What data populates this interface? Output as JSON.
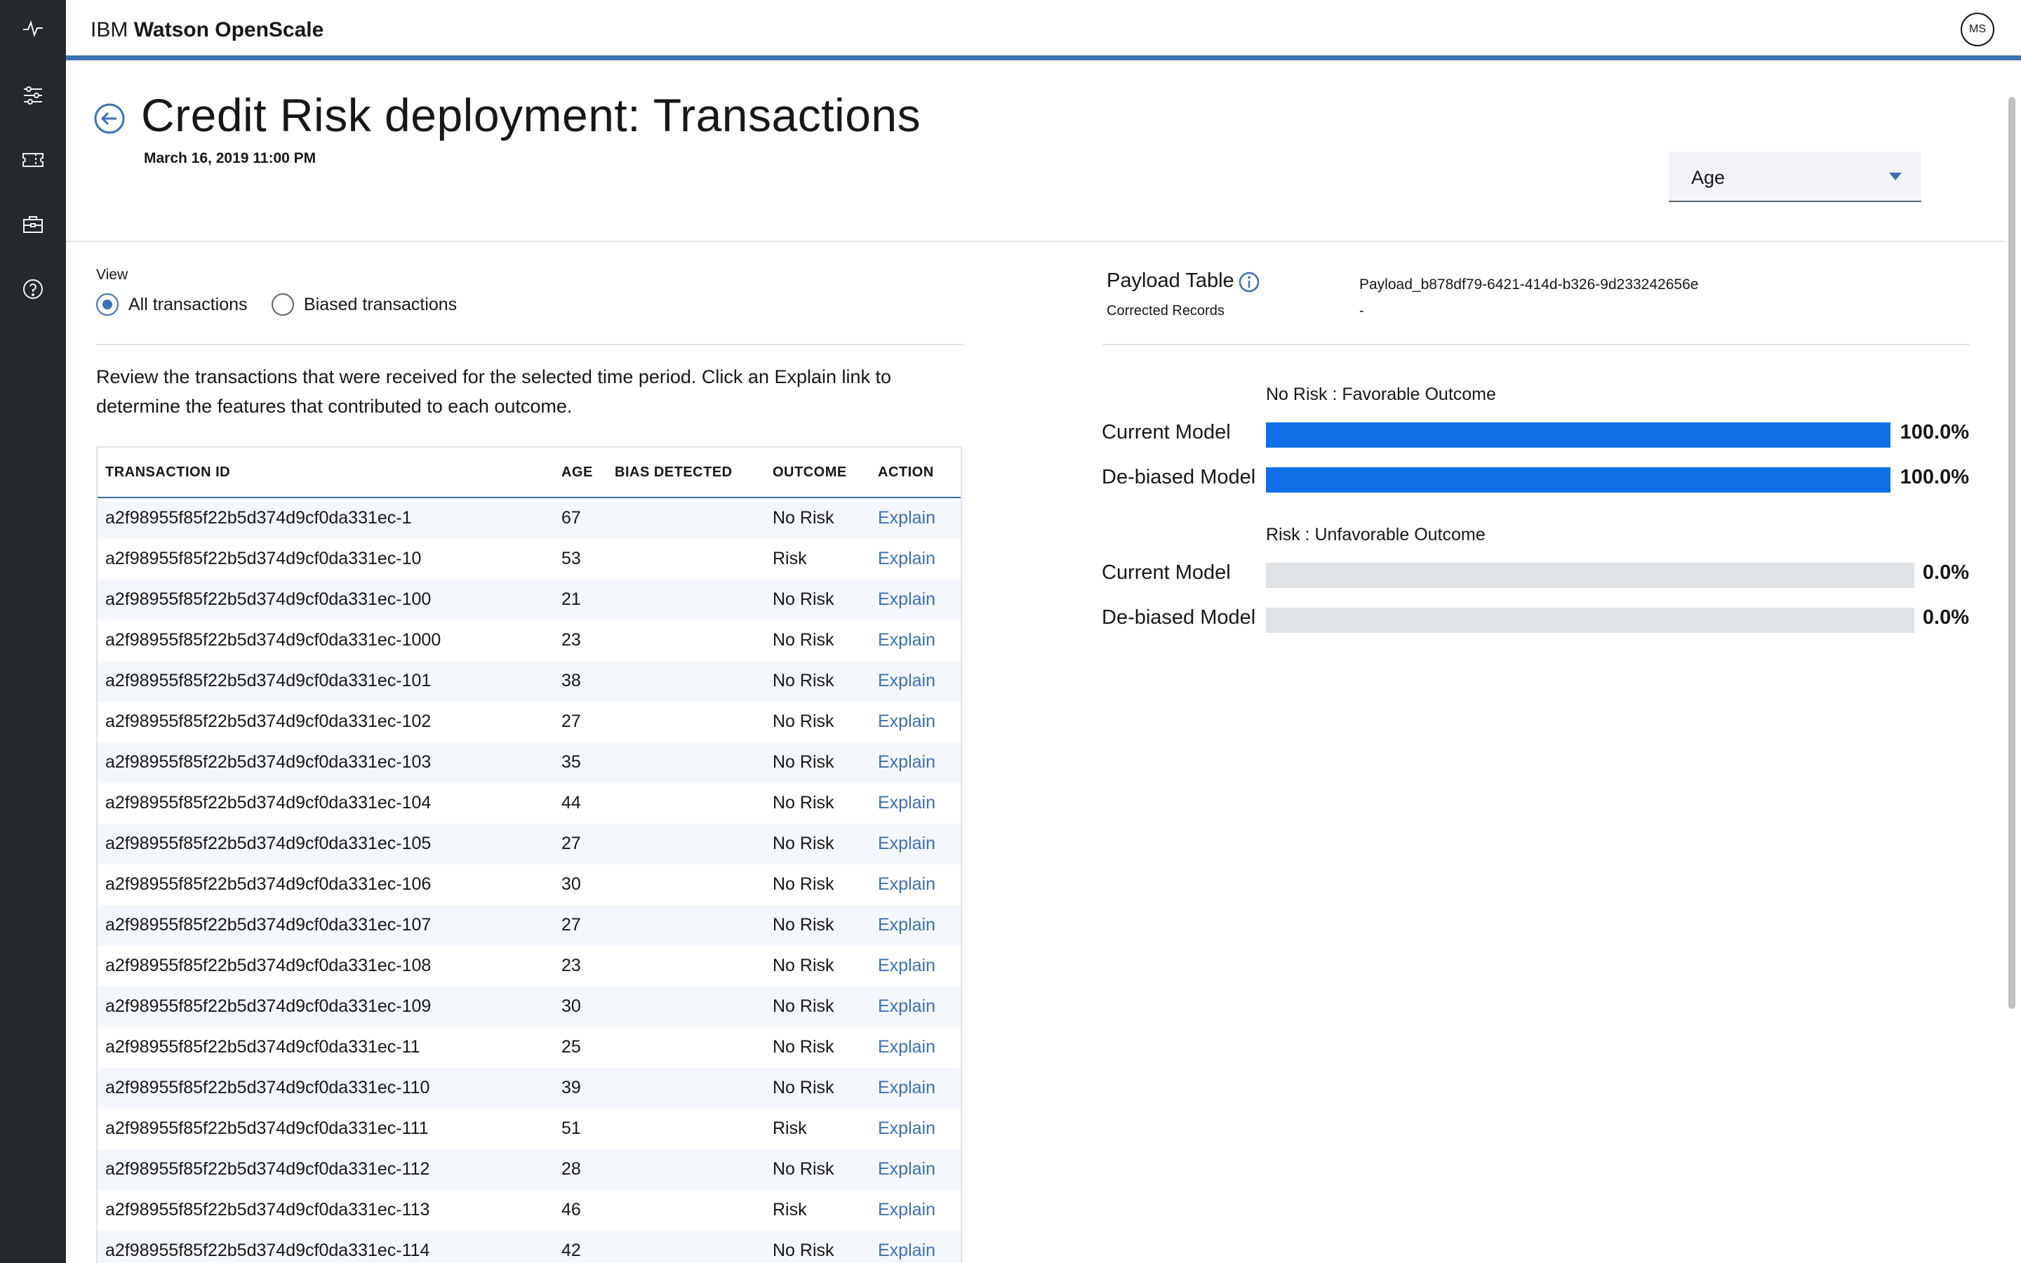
{
  "app": {
    "brand_prefix": "IBM",
    "brand_name": "Watson OpenScale",
    "user_initials": "MS"
  },
  "nav": [
    {
      "name": "activity-icon"
    },
    {
      "name": "sliders-icon"
    },
    {
      "name": "ticket-icon"
    },
    {
      "name": "toolbox-icon"
    },
    {
      "name": "help-icon"
    }
  ],
  "page": {
    "title": "Credit Risk deployment: Transactions",
    "date": "March 16, 2019 11:00 PM",
    "feature_select": "Age"
  },
  "view": {
    "label": "View",
    "options": [
      {
        "label": "All transactions",
        "selected": true
      },
      {
        "label": "Biased transactions",
        "selected": false
      }
    ],
    "description": "Review the transactions that were received for the selected time period. Click an Explain link to determine the features that contributed to each outcome."
  },
  "table": {
    "headers": {
      "id": "TRANSACTION ID",
      "age": "AGE",
      "bias": "BIAS DETECTED",
      "outcome": "OUTCOME",
      "action": "ACTION"
    },
    "rows": [
      {
        "id": "a2f98955f85f22b5d374d9cf0da331ec-1",
        "age": "67",
        "bias": "",
        "outcome": "No Risk",
        "action": "Explain"
      },
      {
        "id": "a2f98955f85f22b5d374d9cf0da331ec-10",
        "age": "53",
        "bias": "",
        "outcome": "Risk",
        "action": "Explain"
      },
      {
        "id": "a2f98955f85f22b5d374d9cf0da331ec-100",
        "age": "21",
        "bias": "",
        "outcome": "No Risk",
        "action": "Explain"
      },
      {
        "id": "a2f98955f85f22b5d374d9cf0da331ec-1000",
        "age": "23",
        "bias": "",
        "outcome": "No Risk",
        "action": "Explain"
      },
      {
        "id": "a2f98955f85f22b5d374d9cf0da331ec-101",
        "age": "38",
        "bias": "",
        "outcome": "No Risk",
        "action": "Explain"
      },
      {
        "id": "a2f98955f85f22b5d374d9cf0da331ec-102",
        "age": "27",
        "bias": "",
        "outcome": "No Risk",
        "action": "Explain"
      },
      {
        "id": "a2f98955f85f22b5d374d9cf0da331ec-103",
        "age": "35",
        "bias": "",
        "outcome": "No Risk",
        "action": "Explain"
      },
      {
        "id": "a2f98955f85f22b5d374d9cf0da331ec-104",
        "age": "44",
        "bias": "",
        "outcome": "No Risk",
        "action": "Explain"
      },
      {
        "id": "a2f98955f85f22b5d374d9cf0da331ec-105",
        "age": "27",
        "bias": "",
        "outcome": "No Risk",
        "action": "Explain"
      },
      {
        "id": "a2f98955f85f22b5d374d9cf0da331ec-106",
        "age": "30",
        "bias": "",
        "outcome": "No Risk",
        "action": "Explain"
      },
      {
        "id": "a2f98955f85f22b5d374d9cf0da331ec-107",
        "age": "27",
        "bias": "",
        "outcome": "No Risk",
        "action": "Explain"
      },
      {
        "id": "a2f98955f85f22b5d374d9cf0da331ec-108",
        "age": "23",
        "bias": "",
        "outcome": "No Risk",
        "action": "Explain"
      },
      {
        "id": "a2f98955f85f22b5d374d9cf0da331ec-109",
        "age": "30",
        "bias": "",
        "outcome": "No Risk",
        "action": "Explain"
      },
      {
        "id": "a2f98955f85f22b5d374d9cf0da331ec-11",
        "age": "25",
        "bias": "",
        "outcome": "No Risk",
        "action": "Explain"
      },
      {
        "id": "a2f98955f85f22b5d374d9cf0da331ec-110",
        "age": "39",
        "bias": "",
        "outcome": "No Risk",
        "action": "Explain"
      },
      {
        "id": "a2f98955f85f22b5d374d9cf0da331ec-111",
        "age": "51",
        "bias": "",
        "outcome": "Risk",
        "action": "Explain"
      },
      {
        "id": "a2f98955f85f22b5d374d9cf0da331ec-112",
        "age": "28",
        "bias": "",
        "outcome": "No Risk",
        "action": "Explain"
      },
      {
        "id": "a2f98955f85f22b5d374d9cf0da331ec-113",
        "age": "46",
        "bias": "",
        "outcome": "Risk",
        "action": "Explain"
      },
      {
        "id": "a2f98955f85f22b5d374d9cf0da331ec-114",
        "age": "42",
        "bias": "",
        "outcome": "No Risk",
        "action": "Explain"
      }
    ]
  },
  "payload": {
    "label": "Payload Table",
    "value": "Payload_b878df79-6421-414d-b326-9d233242656e",
    "corrected_label": "Corrected Records",
    "corrected_value": "-"
  },
  "outcomes": [
    {
      "title": "No Risk : Favorable Outcome",
      "bars": [
        {
          "label": "Current Model",
          "value": "100.0%",
          "fraction": 1.0
        },
        {
          "label": "De-biased Model",
          "value": "100.0%",
          "fraction": 1.0
        }
      ]
    },
    {
      "title": "Risk : Unfavorable Outcome",
      "bars": [
        {
          "label": "Current Model",
          "value": "0.0%",
          "fraction": 0.0
        },
        {
          "label": "De-biased Model",
          "value": "0.0%",
          "fraction": 0.0
        }
      ]
    }
  ],
  "colors": {
    "accent": "#3d70b2",
    "bar_fill": "#0f6ee8",
    "bar_track": "#dfe3e6",
    "rail": "#24292c"
  }
}
